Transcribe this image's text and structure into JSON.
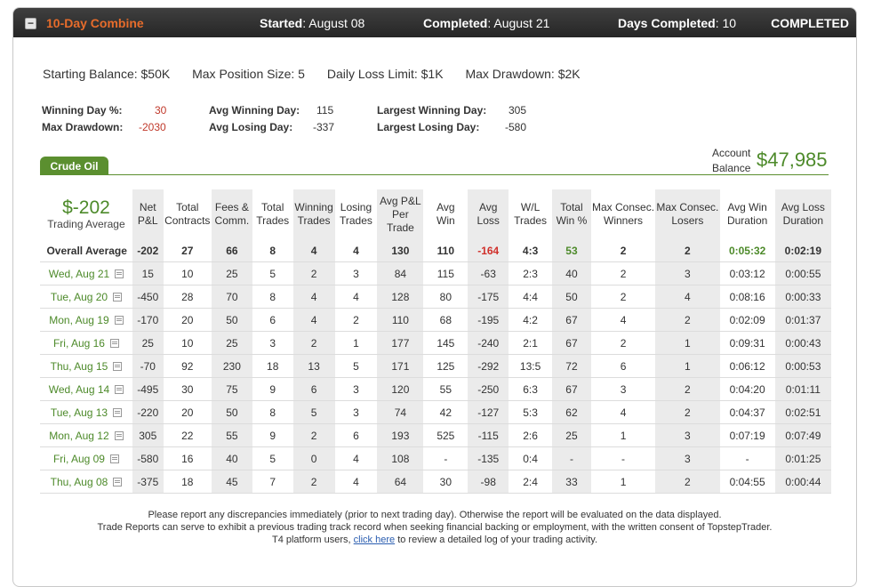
{
  "header": {
    "title": "10-Day Combine",
    "started_label": "Started",
    "started_value": "August 08",
    "completed_label": "Completed",
    "completed_value": "August 21",
    "days_label": "Days Completed",
    "days_value": "10",
    "status": "COMPLETED"
  },
  "summary": {
    "starting_balance": "Starting Balance: $50K",
    "max_position": "Max Position Size: 5",
    "daily_loss": "Daily Loss Limit: $1K",
    "max_drawdown": "Max Drawdown: $2K"
  },
  "stats": {
    "winning_day_label": "Winning Day %:",
    "winning_day_value": "30",
    "max_drawdown_label": "Max Drawdown:",
    "max_drawdown_value": "-2030",
    "avg_winning_day_label": "Avg Winning Day:",
    "avg_winning_day_value": "115",
    "avg_losing_day_label": "Avg Losing Day:",
    "avg_losing_day_value": "-337",
    "largest_winning_label": "Largest Winning Day:",
    "largest_winning_value": "305",
    "largest_losing_label": "Largest Losing Day:",
    "largest_losing_value": "-580"
  },
  "tab": {
    "label": "Crude Oil"
  },
  "account": {
    "label_line1": "Account",
    "label_line2": "Balance",
    "value": "$47,985"
  },
  "trading_average": {
    "value": "$-202",
    "label": "Trading Average"
  },
  "columns": [
    [
      "Net",
      "P&L"
    ],
    [
      "Total",
      "Contracts"
    ],
    [
      "Fees &",
      "Comm."
    ],
    [
      "Total",
      "Trades"
    ],
    [
      "Winning",
      "Trades"
    ],
    [
      "Losing",
      "Trades"
    ],
    [
      "Avg P&L",
      "Per",
      "Trade"
    ],
    [
      "Avg",
      "Win"
    ],
    [
      "Avg",
      "Loss"
    ],
    [
      "W/L",
      "Trades"
    ],
    [
      "Total",
      "Win %"
    ],
    [
      "Max Consec.",
      "Winners"
    ],
    [
      "Max Consec.",
      "Losers"
    ],
    [
      "Avg Win",
      "Duration"
    ],
    [
      "Avg Loss",
      "Duration"
    ]
  ],
  "overall": {
    "label": "Overall Average",
    "cells": [
      "-202",
      "27",
      "66",
      "8",
      "4",
      "4",
      "130",
      "110",
      "-164",
      "4:3",
      "53",
      "2",
      "2",
      "0:05:32",
      "0:02:19"
    ]
  },
  "rows": [
    {
      "date": "Wed, Aug 21",
      "cells": [
        "15",
        "10",
        "25",
        "5",
        "2",
        "3",
        "84",
        "115",
        "-63",
        "2:3",
        "40",
        "2",
        "3",
        "0:03:12",
        "0:00:55"
      ]
    },
    {
      "date": "Tue, Aug 20",
      "cells": [
        "-450",
        "28",
        "70",
        "8",
        "4",
        "4",
        "128",
        "80",
        "-175",
        "4:4",
        "50",
        "2",
        "4",
        "0:08:16",
        "0:00:33"
      ]
    },
    {
      "date": "Mon, Aug 19",
      "cells": [
        "-170",
        "20",
        "50",
        "6",
        "4",
        "2",
        "110",
        "68",
        "-195",
        "4:2",
        "67",
        "4",
        "2",
        "0:02:09",
        "0:01:37"
      ]
    },
    {
      "date": "Fri, Aug 16",
      "cells": [
        "25",
        "10",
        "25",
        "3",
        "2",
        "1",
        "177",
        "145",
        "-240",
        "2:1",
        "67",
        "2",
        "1",
        "0:09:31",
        "0:00:43"
      ]
    },
    {
      "date": "Thu, Aug 15",
      "cells": [
        "-70",
        "92",
        "230",
        "18",
        "13",
        "5",
        "171",
        "125",
        "-292",
        "13:5",
        "72",
        "6",
        "1",
        "0:06:12",
        "0:00:53"
      ]
    },
    {
      "date": "Wed, Aug 14",
      "cells": [
        "-495",
        "30",
        "75",
        "9",
        "6",
        "3",
        "120",
        "55",
        "-250",
        "6:3",
        "67",
        "3",
        "2",
        "0:04:20",
        "0:01:11"
      ]
    },
    {
      "date": "Tue, Aug 13",
      "cells": [
        "-220",
        "20",
        "50",
        "8",
        "5",
        "3",
        "74",
        "42",
        "-127",
        "5:3",
        "62",
        "4",
        "2",
        "0:04:37",
        "0:02:51"
      ]
    },
    {
      "date": "Mon, Aug 12",
      "cells": [
        "305",
        "22",
        "55",
        "9",
        "2",
        "6",
        "193",
        "525",
        "-115",
        "2:6",
        "25",
        "1",
        "3",
        "0:07:19",
        "0:07:49"
      ]
    },
    {
      "date": "Fri, Aug 09",
      "cells": [
        "-580",
        "16",
        "40",
        "5",
        "0",
        "4",
        "108",
        "-",
        "-135",
        "0:4",
        "-",
        "-",
        "3",
        "-",
        "0:01:25"
      ]
    },
    {
      "date": "Thu, Aug 08",
      "cells": [
        "-375",
        "18",
        "45",
        "7",
        "2",
        "4",
        "64",
        "30",
        "-98",
        "2:4",
        "33",
        "1",
        "2",
        "0:04:55",
        "0:00:44"
      ]
    }
  ],
  "footer": {
    "line1": "Please report any discrepancies immediately (prior to next trading day). Otherwise the report will be evaluated on the data displayed.",
    "line2": "Trade Reports can serve to exhibit a previous trading track record when seeking financial backing or employment, with the written consent of TopstepTrader.",
    "line3_pre": "T4 platform users,",
    "line3_link": "click here",
    "line3_post": "to review a detailed log of your trading activity."
  }
}
